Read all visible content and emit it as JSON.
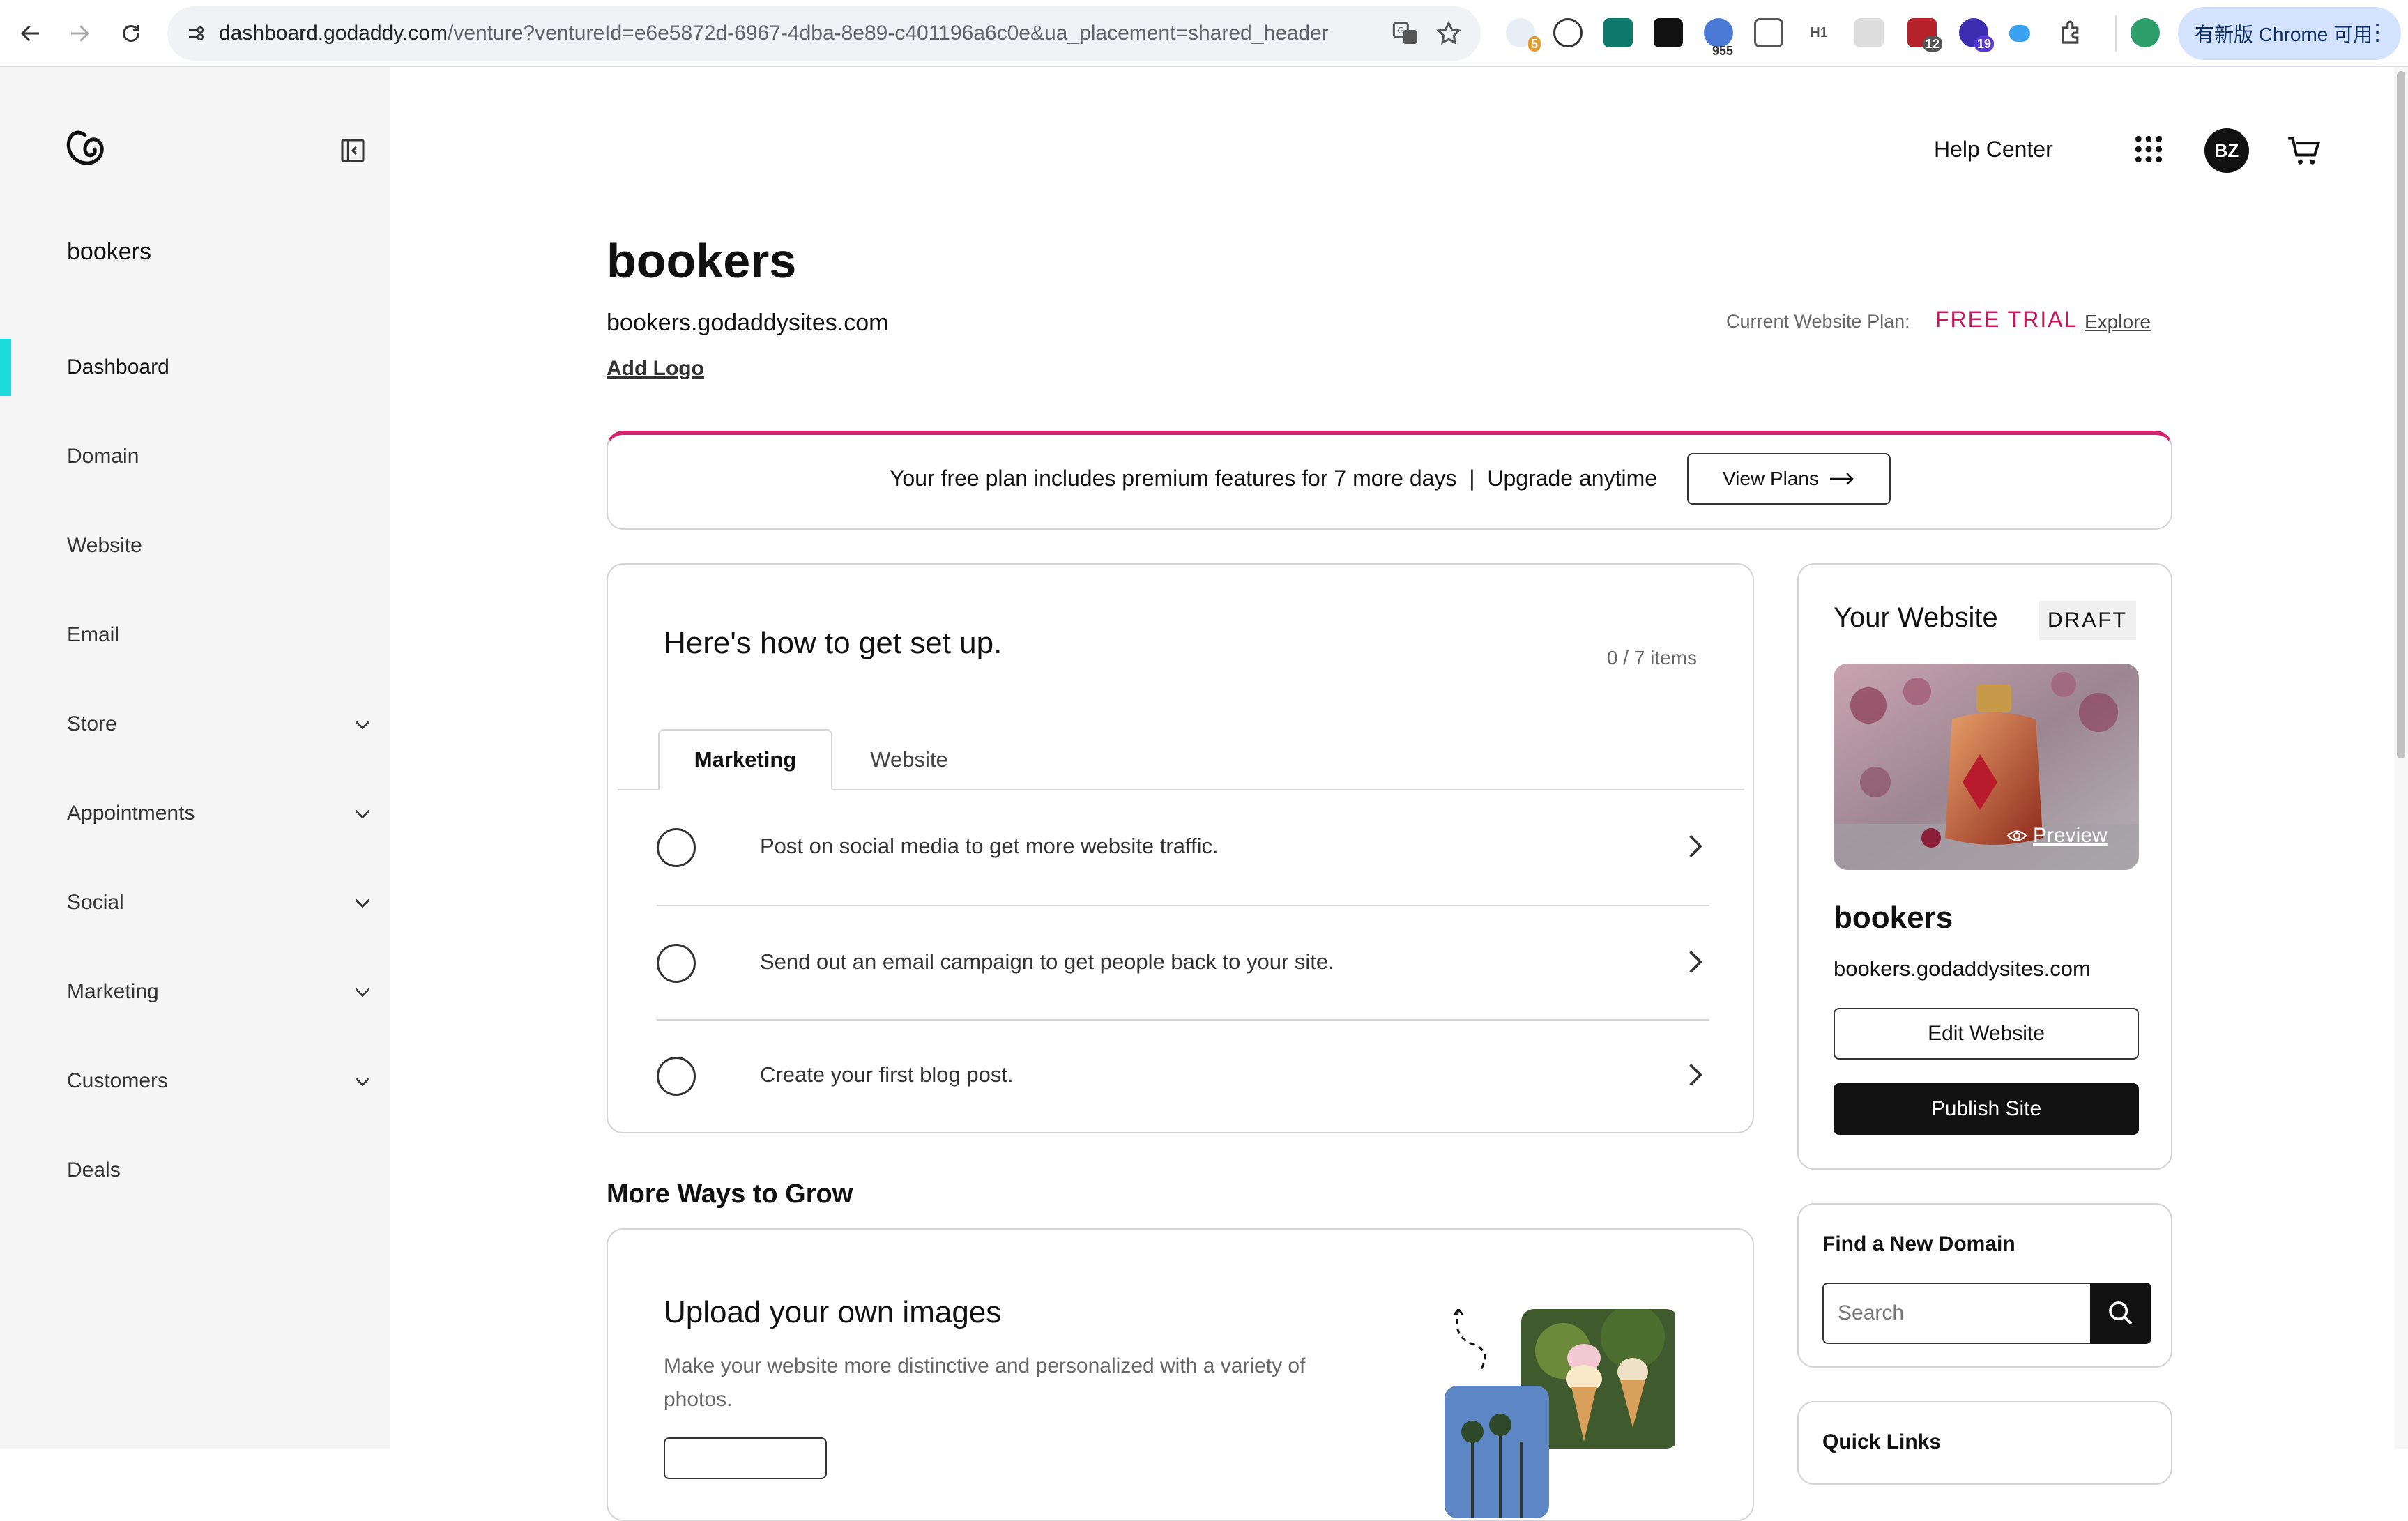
{
  "browser": {
    "url_host": "dashboard.godaddy.com",
    "url_rest": "/venture?ventureId=e6e5872d-6967-4dba-8e89-c401196a6c0e&ua_placement=shared_header",
    "ext_badges": [
      "5",
      "955",
      "12",
      "19"
    ],
    "update_label": "有新版 Chrome 可用"
  },
  "sidebar": {
    "venture_name": "bookers",
    "items": [
      {
        "label": "Dashboard",
        "expandable": false,
        "active": true
      },
      {
        "label": "Domain",
        "expandable": false
      },
      {
        "label": "Website",
        "expandable": false
      },
      {
        "label": "Email",
        "expandable": false
      },
      {
        "label": "Store",
        "expandable": true
      },
      {
        "label": "Appointments",
        "expandable": true
      },
      {
        "label": "Social",
        "expandable": true
      },
      {
        "label": "Marketing",
        "expandable": true
      },
      {
        "label": "Customers",
        "expandable": true
      },
      {
        "label": "Deals",
        "expandable": false
      }
    ]
  },
  "header": {
    "help_center": "Help Center",
    "avatar_initials": "BZ"
  },
  "site": {
    "title": "bookers",
    "url": "bookers.godaddysites.com",
    "add_logo": "Add Logo",
    "plan_label": "Current Website Plan:",
    "plan_value": "FREE TRIAL",
    "plan_explore": "Explore"
  },
  "banner": {
    "text": "Your free plan includes premium features for 7 more days  |  Upgrade anytime",
    "button": "View Plans"
  },
  "setup": {
    "title": "Here's how to get set up.",
    "count": "0 / 7 items",
    "tabs": [
      "Marketing",
      "Website"
    ],
    "tasks": [
      "Post on social media to get more website traffic.",
      "Send out an email campaign to get people back to your site.",
      "Create your first blog post."
    ]
  },
  "website_card": {
    "title": "Your Website",
    "status": "DRAFT",
    "preview": "Preview",
    "name": "bookers",
    "url": "bookers.godaddysites.com",
    "edit": "Edit Website",
    "publish": "Publish Site"
  },
  "grow": {
    "section_title": "More Ways to Grow",
    "title": "Upload your own images",
    "description": "Make your website more distinctive and personalized with a variety of photos."
  },
  "domain": {
    "title": "Find a New Domain",
    "placeholder": "Search"
  },
  "quick_links": {
    "title": "Quick Links"
  },
  "colors": {
    "accent_pink": "#c8185c",
    "active_bar": "#1bdbdb",
    "banner_border": "#d6246e"
  }
}
